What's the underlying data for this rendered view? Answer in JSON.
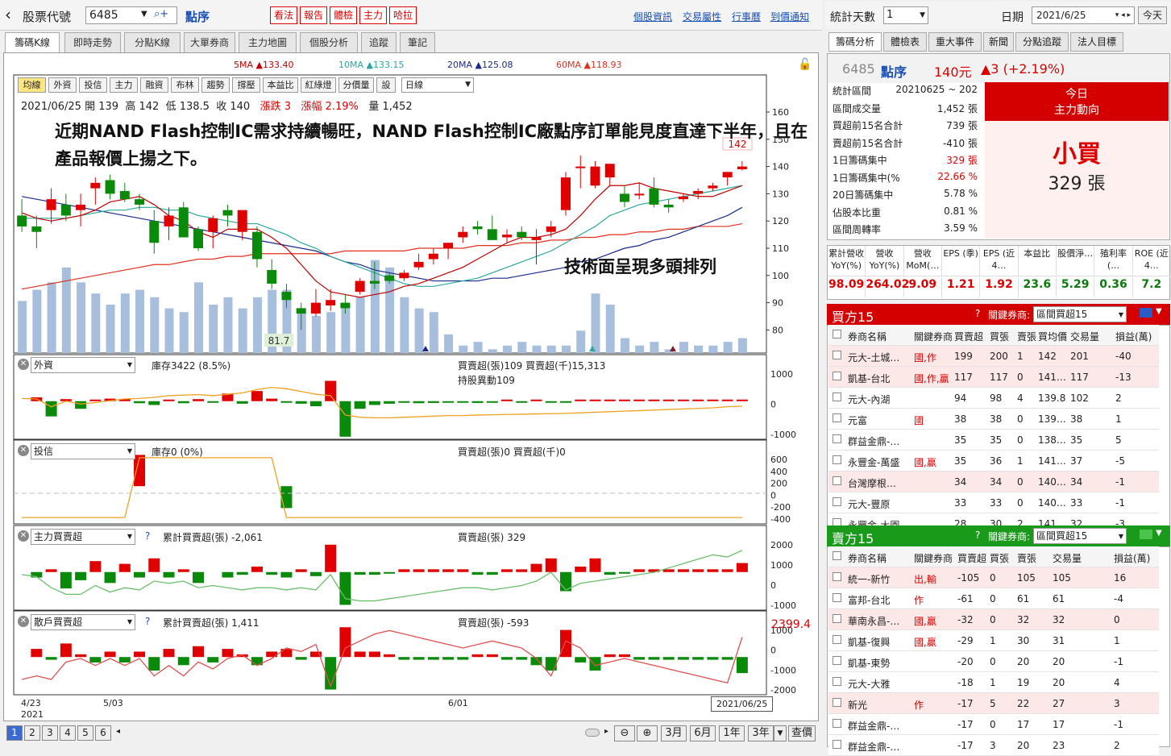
{
  "header": {
    "back_icon": "chevron-left-icon",
    "stock_code_label": "股票代號",
    "stock_code": "6485",
    "stock_name": "點序",
    "red_buttons": [
      "看法",
      "報告",
      "體檢",
      "主力",
      "哈拉"
    ],
    "links": [
      "個股資訊",
      "交易屬性",
      "行事曆",
      "到價通知"
    ]
  },
  "chart_tabs": [
    "籌碼K線",
    "即時走勢",
    "分點K線",
    "大單券商",
    "主力地圖",
    "個股分析",
    "追蹤",
    "筆記"
  ],
  "ma": {
    "ma5": "5MA ▲133.40",
    "ma10": "10MA ▲133.15",
    "ma20": "20MA ▲125.08",
    "ma60": "60MA ▲118.93",
    "colors": {
      "ma5": "#c00000",
      "ma10": "#2aa7a0",
      "ma20": "#1a2a8a",
      "ma60": "#e03020"
    }
  },
  "toolbar": [
    "均線",
    "外資",
    "投信",
    "主力",
    "融資",
    "布林",
    "趨勢",
    "撐壓",
    "本益比",
    "紅綠燈",
    "分價量",
    "設"
  ],
  "toolbar_select": "日線",
  "ohlc": {
    "date": "2021/06/25",
    "open_label": "開",
    "open": "139",
    "high_label": "高",
    "high": "142",
    "low_label": "低",
    "low": "138.5",
    "close_label": "收",
    "close": "140",
    "chg_label": "漲跌",
    "chg": "3",
    "pct_label": "漲幅",
    "pct": "2.19%",
    "vol_label": "量",
    "vol": "1,452"
  },
  "annotation1": "近期NAND Flash控制IC需求持續暢旺，NAND Flash控制IC廠點序訂單能見度直達下半年，且在產品報價上揚之下。",
  "annotation2": "技術面呈現多頭排列",
  "price_axis": [
    "160",
    "150",
    "140",
    "130",
    "120",
    "110",
    "100",
    "90",
    "80"
  ],
  "max_label": "142",
  "min_label": "81.7",
  "sub1": {
    "select": "外資",
    "legend_line": "庫存3422 (8.5%)",
    "legend_bar": "買賣超(張)109 買賣超(千)15,313",
    "legend_bar2": "持股異動109",
    "axis": [
      "1000",
      "0",
      "-1000"
    ]
  },
  "sub2": {
    "select": "投信",
    "legend_line": "庫存0 (0%)",
    "legend_bar": "買賣超(張)0 買賣超(千)0",
    "axis": [
      "600",
      "400",
      "200",
      "0",
      "-200",
      "-400"
    ]
  },
  "sub3": {
    "select": "主力買賣超",
    "legend_line": "累計買賣超(張) -2,061",
    "legend_bar": "買賣超(張) 329",
    "axis": [
      "2000",
      "1000",
      "0",
      "-1000"
    ]
  },
  "sub4": {
    "select": "散戶買賣超",
    "legend_line": "累計買賣超(張) 1,411",
    "legend_bar": "買賣超(張) -593",
    "axis_top": "2399.4",
    "axis": [
      "1000",
      "0",
      "-1000",
      "-2000"
    ]
  },
  "xaxis": {
    "d1": "4/23",
    "y1": "2021",
    "d2": "5/03",
    "d3": "6/01",
    "end": "2021/06/25"
  },
  "bottom": {
    "pages": [
      "1",
      "2",
      "3",
      "4",
      "5",
      "6"
    ],
    "ranges": [
      "3月",
      "6月",
      "1年",
      "3年"
    ],
    "query": "查價"
  },
  "right": {
    "days_label": "統計天數",
    "days": "1",
    "date_label": "日期",
    "date": "2021/6/25",
    "today": "今天",
    "tabs": [
      "籌碼分析",
      "體檢表",
      "重大事件",
      "新聞",
      "分點追蹤",
      "法人目標"
    ],
    "stock_code": "6485",
    "stock_name": "點序",
    "price": "140元",
    "chg": "▲3 (+2.19%)",
    "stats": [
      [
        "統計區間",
        "20210625 ~ 202"
      ],
      [
        "區間成交量",
        "1,452 張"
      ],
      [
        "買超前15名合計",
        "739 張"
      ],
      [
        "賣超前15名合計",
        "-410 張"
      ],
      [
        "1日籌碼集中",
        "329 張"
      ],
      [
        "1日籌碼集中(%",
        "22.66 %"
      ],
      [
        "20日籌碼集中",
        "5.78 %"
      ],
      [
        "佔股本比重",
        "0.81 %"
      ],
      [
        "區間周轉率",
        "3.59 %"
      ]
    ],
    "today_title": "今日",
    "today_sub": "主力動向",
    "today_verdict": "小買",
    "today_amount": "329 張",
    "metrics_head": [
      "累計營收 YoY(%)",
      "營收 YoY(%)",
      "營收 MoM(…",
      "EPS (季)",
      "EPS (近4…",
      "本益比",
      "股價淨…",
      "殖利率 (…",
      "ROE (近4…"
    ],
    "metrics_val": [
      "98.09",
      "264.02",
      "9.09",
      "1.21",
      "1.92",
      "23.6",
      "5.29",
      "0.36",
      "7.2"
    ],
    "buy_title": "買方15",
    "sell_title": "賣方15",
    "key_broker_label": "關鍵券商:",
    "key_broker_select": "區間買超15",
    "cols_buy": [
      "券商名稱",
      "關鍵券商",
      "買賣超",
      "買張",
      "賣張",
      "買均價",
      "交易量",
      "損益(萬)"
    ],
    "cols_sell": [
      "券商名稱",
      "關鍵券商",
      "買賣超",
      "買張",
      "賣張",
      "交易量",
      "損益(萬)"
    ],
    "buy_rows": [
      [
        "元大-土城…",
        "國,作",
        "199",
        "200",
        "1",
        "142",
        "201",
        "-40"
      ],
      [
        "凱基-台北",
        "國,作,贏",
        "117",
        "117",
        "0",
        "141…",
        "117",
        "-13"
      ],
      [
        "元大-內湖",
        "",
        "94",
        "98",
        "4",
        "139.8",
        "102",
        "2"
      ],
      [
        "元富",
        "國",
        "38",
        "38",
        "0",
        "139…",
        "38",
        "1"
      ],
      [
        "群益金鼎-…",
        "",
        "35",
        "35",
        "0",
        "138…",
        "35",
        "5"
      ],
      [
        "永豐金-萬盛",
        "國,贏",
        "35",
        "36",
        "1",
        "141…",
        "37",
        "-5"
      ],
      [
        "台灣摩根…",
        "",
        "34",
        "34",
        "0",
        "140…",
        "34",
        "-1"
      ],
      [
        "元大-豐原",
        "",
        "33",
        "33",
        "0",
        "140…",
        "33",
        "-1"
      ],
      [
        "永豐金-大園",
        "",
        "28",
        "30",
        "2",
        "141",
        "32",
        "-3"
      ]
    ],
    "sell_rows": [
      [
        "統一-新竹",
        "出,輸",
        "-105",
        "0",
        "105",
        "105",
        "16"
      ],
      [
        "富邦-台北",
        "作",
        "-61",
        "0",
        "61",
        "61",
        "-4"
      ],
      [
        "華南永昌-…",
        "國,贏",
        "-32",
        "0",
        "32",
        "32",
        "0"
      ],
      [
        "凱基-復興",
        "國,贏",
        "-29",
        "1",
        "30",
        "31",
        "1"
      ],
      [
        "凱基-東勢",
        "",
        "-20",
        "0",
        "20",
        "20",
        "-1"
      ],
      [
        "元大-大雅",
        "",
        "-18",
        "1",
        "19",
        "20",
        "4"
      ],
      [
        "新光",
        "作",
        "-17",
        "5",
        "22",
        "27",
        "3"
      ],
      [
        "群益金鼎-…",
        "",
        "-17",
        "0",
        "17",
        "17",
        "-1"
      ],
      [
        "群益金鼎-…",
        "",
        "-17",
        "3",
        "20",
        "23",
        "2"
      ]
    ]
  },
  "chart_data": {
    "type": "candlestick",
    "title": "",
    "dates_start": "4/23",
    "dates_end": "2021/06/25",
    "candles": [
      [
        122,
        128,
        116,
        118
      ],
      [
        118,
        122,
        110,
        116
      ],
      [
        124,
        132,
        119,
        128
      ],
      [
        126,
        130,
        120,
        122
      ],
      [
        124,
        130,
        118,
        126
      ],
      [
        132,
        136,
        126,
        134
      ],
      [
        135,
        137,
        128,
        130
      ],
      [
        131,
        134,
        127,
        128
      ],
      [
        128,
        130,
        124,
        126
      ],
      [
        120,
        124,
        108,
        112
      ],
      [
        118,
        125,
        113,
        122
      ],
      [
        125,
        127,
        115,
        114
      ],
      [
        117,
        118,
        109,
        110
      ],
      [
        116,
        122,
        110,
        121
      ],
      [
        124,
        126,
        118,
        122
      ],
      [
        116,
        124,
        113,
        124
      ],
      [
        116,
        118,
        103,
        106
      ],
      [
        102,
        106,
        95,
        97
      ],
      [
        94,
        97,
        88,
        91
      ],
      [
        88,
        90,
        80,
        86
      ],
      [
        86,
        95,
        85,
        90
      ],
      [
        89,
        95,
        87,
        91
      ],
      [
        90,
        93,
        86,
        88
      ],
      [
        94,
        99,
        93,
        98
      ],
      [
        98,
        105,
        95,
        97
      ],
      [
        100,
        101,
        97,
        98
      ],
      [
        99,
        102,
        98,
        101
      ],
      [
        103,
        108,
        102,
        105
      ],
      [
        106,
        110,
        104,
        108
      ],
      [
        110,
        112,
        106,
        112
      ],
      [
        114,
        118,
        112,
        116
      ],
      [
        118,
        120,
        115,
        117
      ],
      [
        117,
        122,
        114,
        113
      ],
      [
        114,
        117,
        112,
        115
      ],
      [
        116,
        118,
        113,
        114
      ],
      [
        113,
        117,
        104,
        114
      ],
      [
        116,
        120,
        114,
        118
      ],
      [
        124,
        138,
        122,
        136
      ],
      [
        140,
        144,
        132,
        140
      ],
      [
        133,
        142,
        132,
        140
      ],
      [
        136,
        141,
        133,
        141
      ],
      [
        130,
        133,
        125,
        127
      ],
      [
        130,
        134,
        128,
        130
      ],
      [
        132,
        136,
        125,
        126
      ],
      [
        126,
        128,
        123,
        125
      ],
      [
        128,
        130,
        127,
        129
      ],
      [
        130,
        132,
        128,
        131
      ],
      [
        132,
        134,
        131,
        133
      ],
      [
        136,
        138,
        133,
        138
      ],
      [
        139,
        142,
        138.5,
        140
      ]
    ],
    "volume": [
      1400,
      1700,
      1900,
      2300,
      1900,
      1600,
      1300,
      1600,
      1700,
      1500,
      1200,
      1100,
      1900,
      1300,
      1500,
      1200,
      1500,
      1700,
      1700,
      1200,
      1000,
      1100,
      1300,
      1500,
      2500,
      2300,
      1500,
      1200,
      1100,
      500,
      200,
      300,
      100,
      200,
      300,
      200,
      200,
      200,
      600,
      1600,
      1300,
      400,
      200,
      300,
      100,
      300,
      200,
      200,
      300,
      400
    ],
    "ma5": [
      123,
      121,
      120,
      121,
      122,
      124,
      127,
      128,
      129,
      126,
      122,
      120,
      116,
      114,
      117,
      117,
      117,
      114,
      110,
      104,
      98,
      94,
      93,
      92,
      93,
      94,
      96,
      97,
      99,
      101,
      103,
      106,
      109,
      112,
      114,
      114,
      115,
      117,
      122,
      128,
      133,
      133,
      134,
      132,
      131,
      130,
      129,
      129,
      131,
      133
    ],
    "ma10": [
      121,
      121,
      121,
      121,
      122,
      123,
      124,
      124,
      125,
      125,
      124,
      124,
      122,
      121,
      120,
      119,
      119,
      117,
      115,
      112,
      110,
      107,
      105,
      103,
      101,
      99,
      97,
      96,
      96,
      97,
      98,
      99,
      101,
      103,
      105,
      107,
      109,
      112,
      115,
      118,
      122,
      124,
      126,
      127,
      128,
      129,
      130,
      131,
      132,
      133
    ],
    "ma20": [
      129,
      128,
      127,
      126,
      125,
      124,
      123,
      122,
      121,
      120,
      119,
      118,
      117,
      116,
      115,
      114,
      113,
      112,
      111,
      110,
      109,
      107,
      105,
      104,
      102,
      101,
      100,
      99,
      98,
      98,
      98,
      98,
      99,
      99,
      100,
      101,
      102,
      103,
      105,
      106,
      108,
      110,
      111,
      113,
      114,
      116,
      118,
      120,
      122,
      125
    ],
    "ma60": [
      95,
      96,
      97,
      98,
      99,
      100,
      101,
      102,
      103,
      104,
      104,
      105,
      106,
      106,
      107,
      107,
      108,
      108,
      108,
      108,
      108,
      108,
      109,
      109,
      109,
      109,
      109,
      110,
      110,
      110,
      110,
      111,
      111,
      111,
      112,
      112,
      113,
      113,
      114,
      114,
      115,
      115,
      116,
      116,
      117,
      117,
      118,
      118,
      118,
      119
    ],
    "sub1_bars": [
      0,
      150,
      -600,
      80,
      -300,
      50,
      100,
      80,
      -80,
      -150,
      50,
      -80,
      80,
      -60,
      300,
      -100,
      400,
      100,
      -40,
      -100,
      -200,
      800,
      -1400,
      -300,
      -150,
      -100,
      -60,
      -80,
      -70,
      -60,
      -60,
      -70,
      -60,
      60,
      -60,
      60,
      -60,
      -60,
      60,
      60,
      60,
      60,
      60,
      60,
      60,
      60,
      60,
      60,
      60,
      60
    ],
    "sub1_line": [
      -200,
      -220,
      -500,
      -300,
      -400,
      -350,
      -280,
      -220,
      -200,
      -160,
      -100,
      -80,
      -60,
      -100,
      -50,
      0,
      120,
      200,
      150,
      50,
      -50,
      -100,
      -800,
      -880,
      -900,
      -900,
      -880,
      -860,
      -840,
      -820,
      -820,
      -800,
      -790,
      -780,
      -770,
      -760,
      -750,
      -740,
      -720,
      -700,
      -680,
      -660,
      -640,
      -620,
      -600,
      -580,
      -560,
      -540,
      -500,
      -480
    ],
    "sub2_bars": [
      0,
      0,
      0,
      0,
      0,
      0,
      0,
      0,
      400,
      0,
      0,
      0,
      0,
      0,
      0,
      0,
      0,
      0,
      -280,
      0,
      0,
      0,
      0,
      0,
      0,
      0,
      0,
      0,
      0,
      0,
      0,
      0,
      0,
      0,
      0,
      0,
      0,
      0,
      0,
      0,
      0,
      0,
      0,
      0,
      0,
      0,
      0,
      0,
      0,
      0
    ],
    "sub2_line": [
      -400,
      -400,
      -400,
      -400,
      -400,
      -400,
      -400,
      -400,
      400,
      400,
      400,
      400,
      400,
      400,
      400,
      400,
      400,
      400,
      -400,
      -400,
      -400,
      -400,
      -400,
      -400,
      -400,
      -400,
      -400,
      -400,
      -400,
      -400,
      -400,
      -400,
      -400,
      -400,
      -400,
      -400,
      -400,
      -400,
      -400,
      -400,
      -400,
      -400,
      -400,
      -400,
      -400,
      -400,
      -400,
      -400,
      -400,
      -400
    ],
    "sub3_bars": [
      0,
      -200,
      100,
      -600,
      -300,
      400,
      -400,
      300,
      -200,
      500,
      -200,
      100,
      -400,
      0,
      -200,
      -100,
      200,
      -100,
      -200,
      100,
      -150,
      1000,
      -1200,
      -100,
      -100,
      -60,
      100,
      100,
      100,
      100,
      100,
      -100,
      -100,
      100,
      100,
      300,
      500,
      -700,
      200,
      500,
      -100,
      -60,
      100,
      100,
      100,
      100,
      100,
      100,
      100,
      329
    ],
    "sub3_line": [
      -100,
      -200,
      -700,
      -1000,
      -1000,
      -600,
      -900,
      -700,
      -800,
      -400,
      -500,
      -400,
      -700,
      -600,
      -700,
      -800,
      -700,
      -700,
      -800,
      -700,
      -800,
      -100,
      -1200,
      -1300,
      -1300,
      -1200,
      -1100,
      -1000,
      -900,
      -800,
      -700,
      -700,
      -800,
      -700,
      -600,
      -400,
      0,
      -800,
      -500,
      -400,
      -300,
      -200,
      -100,
      0,
      200,
      400,
      600,
      800,
      700,
      1000
    ],
    "sub4_bars": [
      0,
      300,
      -100,
      500,
      100,
      -200,
      200,
      -200,
      200,
      -500,
      300,
      -300,
      400,
      -200,
      300,
      100,
      -300,
      200,
      300,
      -100,
      200,
      -1200,
      1100,
      200,
      200,
      100,
      -100,
      -100,
      -100,
      -100,
      -100,
      100,
      100,
      -100,
      -100,
      -300,
      -500,
      1000,
      -200,
      -500,
      100,
      100,
      -100,
      -100,
      -100,
      -100,
      -100,
      -100,
      -100,
      -593
    ],
    "sub4_line": [
      200,
      300,
      200,
      700,
      800,
      600,
      800,
      600,
      800,
      300,
      600,
      300,
      700,
      500,
      800,
      900,
      600,
      800,
      1100,
      1000,
      1200,
      0,
      1100,
      1300,
      1500,
      1600,
      1500,
      1400,
      1300,
      1200,
      1100,
      1200,
      1300,
      1200,
      1100,
      800,
      300,
      1300,
      1100,
      600,
      700,
      800,
      700,
      600,
      500,
      400,
      300,
      200,
      100,
      1411
    ]
  }
}
